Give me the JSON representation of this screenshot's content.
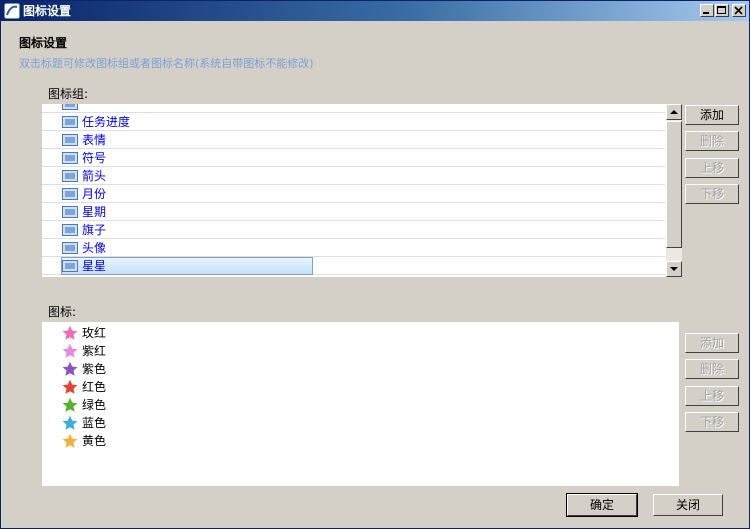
{
  "window": {
    "title": "图标设置"
  },
  "header": {
    "heading": "图标设置",
    "hint": "双击标题可修改图标组或者图标名称(系统自带图标不能修改)"
  },
  "group_panel": {
    "label": "图标组:",
    "items": [
      {
        "label": "任务进度"
      },
      {
        "label": "表情"
      },
      {
        "label": "符号"
      },
      {
        "label": "箭头"
      },
      {
        "label": "月份"
      },
      {
        "label": "星期"
      },
      {
        "label": "旗子"
      },
      {
        "label": "头像"
      },
      {
        "label": "星星",
        "selected": true
      }
    ],
    "buttons": {
      "add": "添加",
      "delete": "删除",
      "move_up": "上移",
      "move_down": "下移"
    }
  },
  "icon_panel": {
    "label": "图标:",
    "items": [
      {
        "label": "玫红",
        "color": "#f06ab4"
      },
      {
        "label": "紫红",
        "color": "#e58ae0"
      },
      {
        "label": "紫色",
        "color": "#8a52c8"
      },
      {
        "label": "红色",
        "color": "#e8412c"
      },
      {
        "label": "绿色",
        "color": "#58b02c"
      },
      {
        "label": "蓝色",
        "color": "#3aaee0"
      },
      {
        "label": "黄色",
        "color": "#f0b040"
      }
    ],
    "buttons": {
      "add": "添加",
      "delete": "删除",
      "move_up": "上移",
      "move_down": "下移"
    }
  },
  "footer": {
    "ok": "确定",
    "close": "关闭"
  }
}
